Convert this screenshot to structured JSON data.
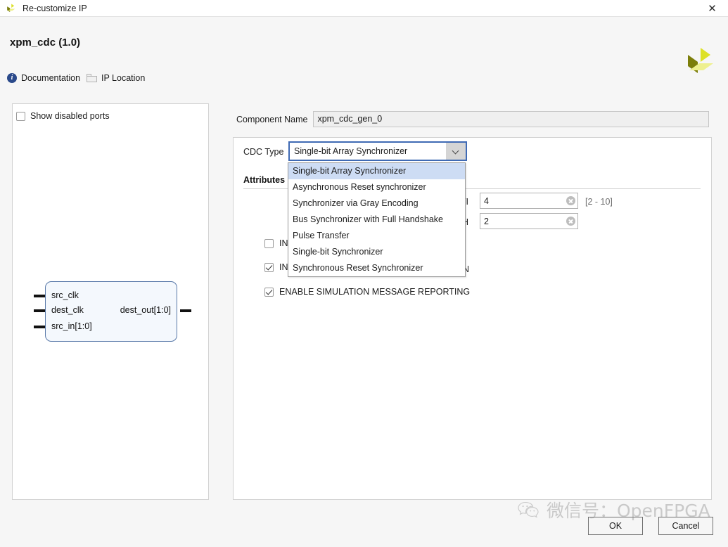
{
  "window": {
    "title": "Re-customize IP",
    "close_label": "✕",
    "logo_name": "xilinx-logo"
  },
  "header": {
    "ip_title": "xpm_cdc (1.0)"
  },
  "links": [
    {
      "label": "Documentation",
      "icon": "info-icon"
    },
    {
      "label": "IP Location",
      "icon": "folder-icon"
    }
  ],
  "preview": {
    "show_disabled_ports": {
      "label": "Show disabled ports",
      "checked": false
    },
    "symbol": {
      "inputs": [
        "src_clk",
        "dest_clk",
        "src_in[1:0]"
      ],
      "outputs": [
        "dest_out[1:0]"
      ]
    }
  },
  "component": {
    "label": "Component Name",
    "value": "xpm_cdc_gen_0"
  },
  "config": {
    "cdc_type": {
      "label": "CDC Type",
      "value": "Single-bit Array Synchronizer",
      "expanded": true,
      "options": [
        "Single-bit Array Synchronizer",
        "Asynchronous Reset synchronizer",
        "Synchronizer via Gray Encoding",
        "Bus Synchronizer with Full Handshake",
        "Pulse Transfer",
        "Single-bit Synchronizer",
        "Synchronous Reset Synchronizer"
      ],
      "selected_index": 0
    },
    "attributes_label": "Attributes",
    "fields": [
      {
        "label": "DESTINATION SYNC FF",
        "label_visible": "DESTI",
        "value": "4",
        "range_hint": "[2 - 10]"
      },
      {
        "label": "WIDTH",
        "label_visible": "WIDTH",
        "value": "2",
        "range_hint": ""
      }
    ],
    "options": [
      {
        "label": "INITIALIZE REGISTERS",
        "label_visible": "INI",
        "checked": false
      },
      {
        "label": "INIT SYNC FF",
        "label_visible": "INI",
        "label_tail": "N",
        "checked": true
      },
      {
        "label": "ENABLE SIMULATION MESSAGE REPORTING",
        "label_visible": "ENABLE SIMULATION MESSAGE REPORTING",
        "checked": true
      }
    ]
  },
  "footer": {
    "ok_label": "OK",
    "cancel_label": "Cancel"
  },
  "watermark": {
    "text": "微信号：OpenFPGA",
    "logo_name": "wechat-icon"
  },
  "colors": {
    "accent_border": "#3f6ab4",
    "dropdown_selected": "#cddcf4",
    "panel_bg": "#ffffff",
    "window_bg": "#f6f6f6",
    "logo_yellow": "#e0e52a",
    "logo_olive": "#7a7c0a"
  }
}
